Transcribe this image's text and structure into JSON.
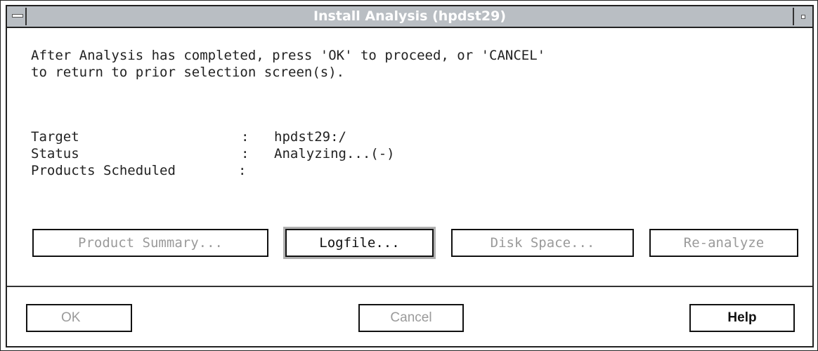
{
  "window": {
    "title": "Install Analysis (hpdst29)"
  },
  "message": {
    "line1": "After Analysis has completed, press 'OK' to proceed, or 'CANCEL'",
    "line2": "to return to prior selection screen(s)."
  },
  "fields": [
    {
      "label": "Target",
      "colon": ":",
      "value": "hpdst29:/"
    },
    {
      "label": "Status",
      "colon": ":",
      "value": "Analyzing...(-)"
    },
    {
      "label": "Products Scheduled",
      "colon": ":",
      "value": ""
    }
  ],
  "action_buttons": {
    "product_summary": "Product Summary...",
    "logfile": "Logfile...",
    "disk_space": "Disk Space...",
    "reanalyze": "Re-analyze"
  },
  "dialog_buttons": {
    "ok": "OK",
    "cancel": "Cancel",
    "help": "Help"
  }
}
